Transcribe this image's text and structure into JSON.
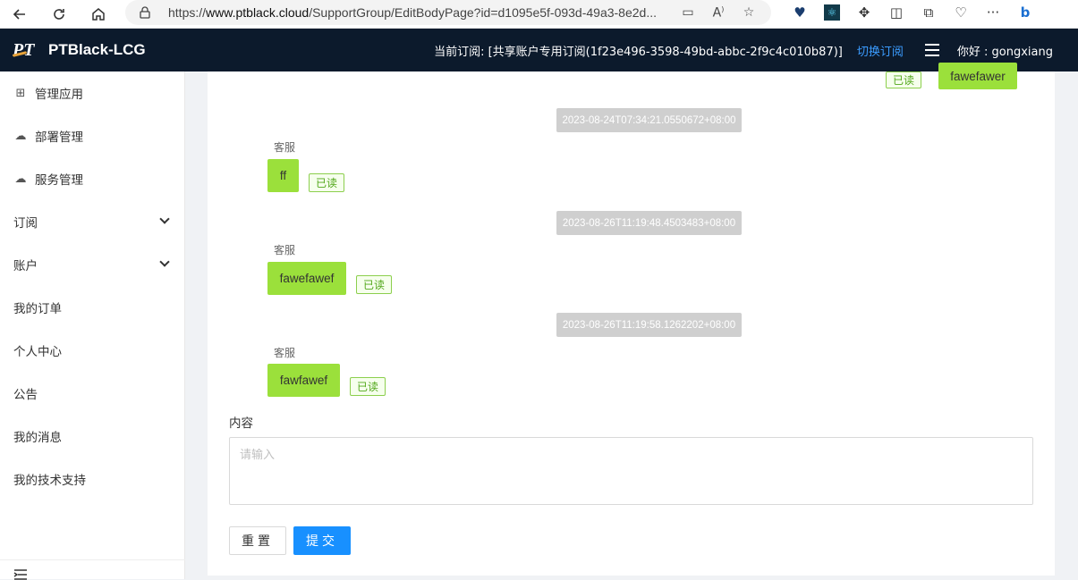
{
  "browser": {
    "url_prefix": "https://",
    "url_domain": "www.ptblack.cloud",
    "url_path": "/SupportGroup/EditBodyPage?id=d1095e5f-093d-49a3-8e2d...",
    "icons": [
      "back-icon",
      "refresh-icon",
      "home-icon",
      "lock-icon",
      "tab-icon",
      "read-aloud-icon",
      "favorite-icon",
      "heart-extension-icon",
      "react-extension-icon",
      "extensions-icon",
      "split-screen-icon",
      "collections-icon",
      "performance-icon",
      "more-icon",
      "bing-icon"
    ]
  },
  "header": {
    "logo": "PT",
    "title": "PTBlack-LCG",
    "subscription_label": "当前订阅: [共享账户专用订阅(1f23e496-3598-49bd-abbc-2f9c4c010b87)]",
    "switch_label": "切换订阅",
    "greeting": "你好 : gongxiang"
  },
  "sidebar": {
    "items": [
      {
        "label": "管理应用",
        "icon": "apps-icon"
      },
      {
        "label": "部署管理",
        "icon": "cloud-upload-icon"
      },
      {
        "label": "服务管理",
        "icon": "cloud-service-icon"
      },
      {
        "label": "订阅",
        "expandable": true
      },
      {
        "label": "账户",
        "expandable": true
      },
      {
        "label": "我的订单"
      },
      {
        "label": "个人中心"
      },
      {
        "label": "公告"
      },
      {
        "label": "我的消息"
      },
      {
        "label": "我的技术支持"
      }
    ]
  },
  "chat": {
    "top_partial": {
      "read": "已读",
      "text": "fawefawer"
    },
    "messages": [
      {
        "timestamp": "2023-08-24T07:34:21.0550672+08:00",
        "sender": "客服",
        "text": "ff",
        "read": "已读"
      },
      {
        "timestamp": "2023-08-26T11:19:48.4503483+08:00",
        "sender": "客服",
        "text": "fawefawef",
        "read": "已读"
      },
      {
        "timestamp": "2023-08-26T11:19:58.1262202+08:00",
        "sender": "客服",
        "text": "fawfawef",
        "read": "已读"
      }
    ]
  },
  "form": {
    "label": "内容",
    "placeholder": "请输入",
    "value": "",
    "reset_label": "重置",
    "submit_label": "提交"
  },
  "colors": {
    "header_bg": "#0c1a2c",
    "accent": "#1890ff",
    "bubble": "#9be03b",
    "read_tag": "#52a71a",
    "timestamp_bg": "#cfcfcf"
  }
}
